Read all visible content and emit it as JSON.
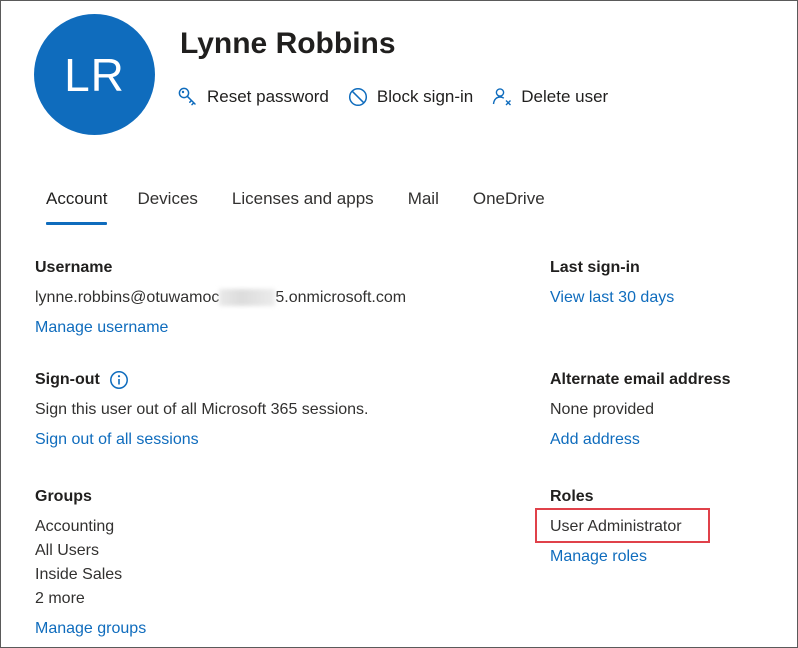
{
  "user": {
    "initials": "LR",
    "name": "Lynne Robbins",
    "avatar_color": "#0f6cbd"
  },
  "actions": [
    {
      "label": "Reset password",
      "icon": "key-icon"
    },
    {
      "label": "Block sign-in",
      "icon": "block-icon"
    },
    {
      "label": "Delete user",
      "icon": "delete-user-icon"
    }
  ],
  "tabs": [
    {
      "label": "Account",
      "active": true
    },
    {
      "label": "Devices"
    },
    {
      "label": "Licenses and apps"
    },
    {
      "label": "Mail"
    },
    {
      "label": "OneDrive"
    }
  ],
  "username": {
    "title": "Username",
    "value_prefix": "lynne.robbins@otuwamoc",
    "value_suffix": "5.onmicrosoft.com",
    "link": "Manage username"
  },
  "signout": {
    "title": "Sign-out",
    "text": "Sign this user out of all Microsoft 365 sessions.",
    "link": "Sign out of all sessions"
  },
  "groups": {
    "title": "Groups",
    "items": [
      "Accounting",
      "All Users",
      "Inside Sales",
      "2 more"
    ],
    "link": "Manage groups"
  },
  "last_signin": {
    "title": "Last sign-in",
    "link": "View last 30 days"
  },
  "alt_email": {
    "title": "Alternate email address",
    "text": "None provided",
    "link": "Add address"
  },
  "roles": {
    "title": "Roles",
    "value": "User Administrator",
    "link": "Manage roles"
  },
  "colors": {
    "accent": "#0f6cbd",
    "highlight": "#e0414a"
  }
}
